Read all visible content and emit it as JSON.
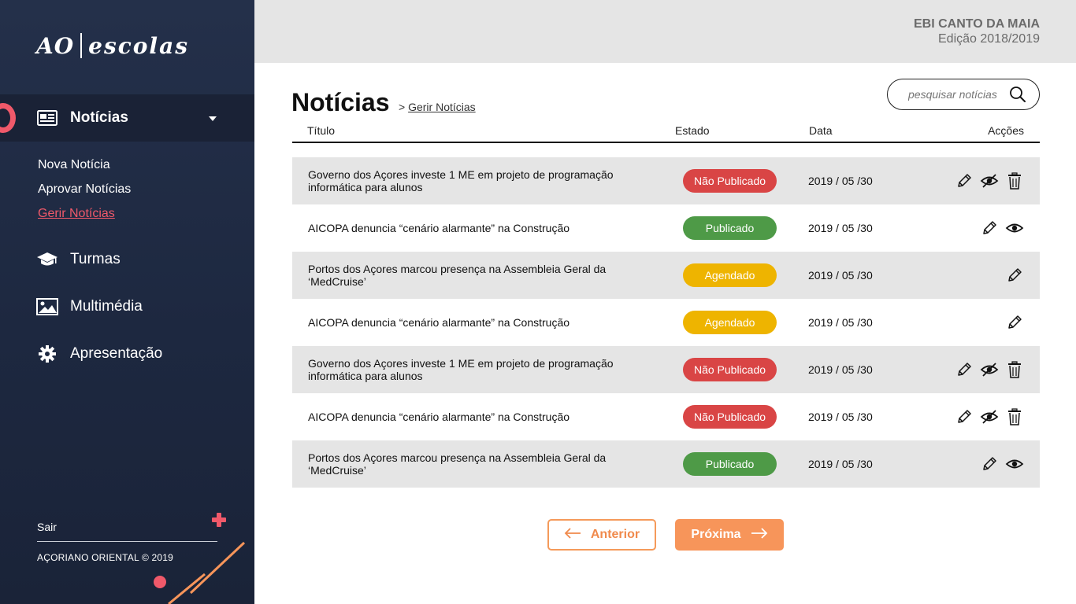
{
  "sidebar": {
    "logo_left": "AO",
    "logo_right": "escolas",
    "nav": {
      "noticias": "Notícias",
      "turmas": "Turmas",
      "multimedia": "Multimédia",
      "apresentacao": "Apresentação"
    },
    "subnav": {
      "nova": "Nova Notícia",
      "aprovar": "Aprovar Notícias",
      "gerir": "Gerir Notícias"
    },
    "sair": "Sair",
    "copyright": "AÇORIANO ORIENTAL © 2019"
  },
  "header": {
    "school_name": "EBI CANTO DA MAIA",
    "school_year": "Edição 2018/2019"
  },
  "main": {
    "title": "Notícias",
    "breadcrumb_sep": ">",
    "breadcrumb_link": "Gerir Notícias",
    "search_placeholder": "pesquisar notícias",
    "columns": {
      "titulo": "Título",
      "estado": "Estado",
      "data": "Data",
      "accoes": "Acções"
    },
    "rows": [
      {
        "title": "Governo dos Açores investe 1 ME em projeto de programação informática para alunos",
        "status": "Não Publicado",
        "date": "2019 / 05 /30"
      },
      {
        "title": "AICOPA denuncia “cenário alarmante” na Construção",
        "status": "Publicado",
        "date": "2019 / 05 /30"
      },
      {
        "title": "Portos dos Açores marcou presença na Assembleia Geral da ‘MedCruise’",
        "status": "Agendado",
        "date": "2019 / 05 /30"
      },
      {
        "title": "AICOPA denuncia “cenário alarmante” na Construção",
        "status": "Agendado",
        "date": "2019 / 05 /30"
      },
      {
        "title": "Governo dos Açores investe 1 ME em projeto de programação informática para alunos",
        "status": "Não Publicado",
        "date": "2019 / 05 /30"
      },
      {
        "title": "AICOPA denuncia “cenário alarmante” na Construção",
        "status": "Não Publicado",
        "date": "2019 / 05 /30"
      },
      {
        "title": "Portos dos Açores marcou presença na Assembleia Geral da ‘MedCruise’",
        "status": "Publicado",
        "date": "2019 / 05 /30"
      }
    ],
    "pagination": {
      "prev": "Anterior",
      "next": "Próxima"
    }
  },
  "colors": {
    "accent_pink": "#f0596a",
    "accent_orange": "#f7955a",
    "status_nao_publicado": "#d94545",
    "status_publicado": "#4e9a47",
    "status_agendado": "#eeb400",
    "sidebar_bg": "#1d2840"
  }
}
